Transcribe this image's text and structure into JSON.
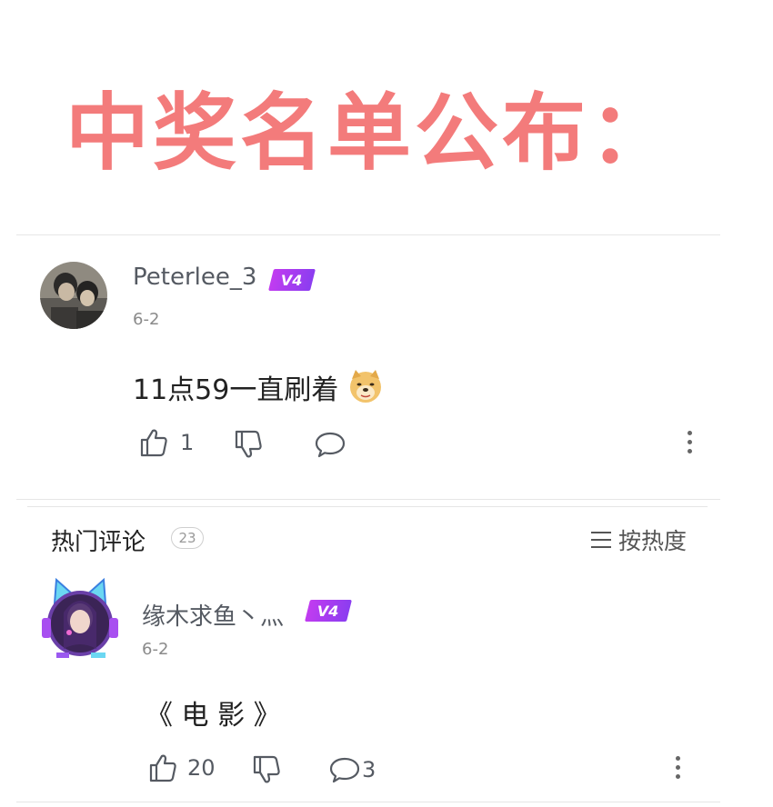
{
  "banner": {
    "text": "中奖名单公布：",
    "color": "#f37b7b"
  },
  "comment1": {
    "username": "Peterlee_3",
    "badge": "V4",
    "date": "6-2",
    "text": "11点59一直刷着",
    "emoji": "doge-emoji",
    "likes": "1"
  },
  "hot": {
    "title": "热门评论",
    "count": "23",
    "sort_label": "按热度"
  },
  "comment2": {
    "username": "缘木求鱼丶灬",
    "badge": "V4",
    "date": "6-2",
    "text": "《 电 影 》",
    "likes": "20",
    "replies": "3"
  },
  "colors": {
    "badge": "#b43cf0",
    "icon": "#555a62"
  }
}
